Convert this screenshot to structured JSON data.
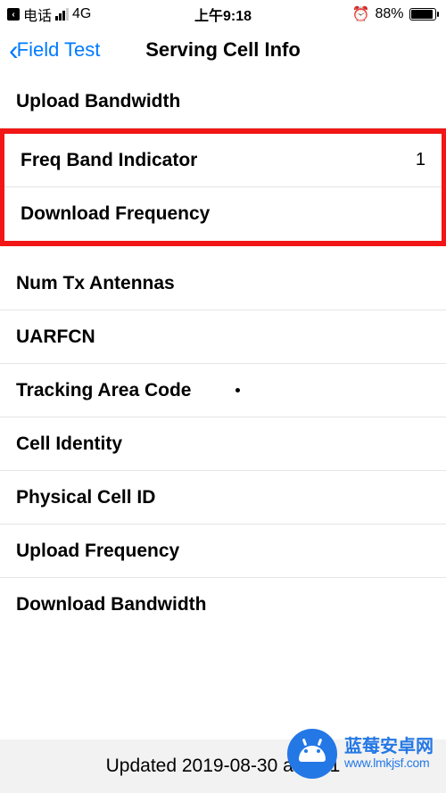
{
  "status": {
    "carrier": "电话",
    "network": "4G",
    "time": "上午9:18",
    "battery_pct": "88%"
  },
  "nav": {
    "back_label": "Field Test",
    "title": "Serving Cell Info"
  },
  "rows": {
    "upload_bw": {
      "label": "Upload Bandwidth",
      "value": ""
    },
    "fbi": {
      "label": "Freq Band Indicator",
      "value": "1"
    },
    "dl_freq": {
      "label": "Download Frequency",
      "value": ""
    },
    "num_tx": {
      "label": "Num Tx Antennas",
      "value": ""
    },
    "uarfcn": {
      "label": "UARFCN",
      "value": ""
    },
    "tac": {
      "label": "Tracking Area Code",
      "value": ""
    },
    "cid": {
      "label": "Cell Identity",
      "value": ""
    },
    "pci": {
      "label": "Physical Cell ID",
      "value": ""
    },
    "ul_freq": {
      "label": "Upload Frequency",
      "value": ""
    },
    "dl_bw": {
      "label": "Download Bandwidth",
      "value": ""
    }
  },
  "footer": {
    "updated": "Updated 2019-08-30 at 09:1"
  },
  "watermark": {
    "title": "蓝莓安卓网",
    "url": "www.lmkjsf.com"
  }
}
